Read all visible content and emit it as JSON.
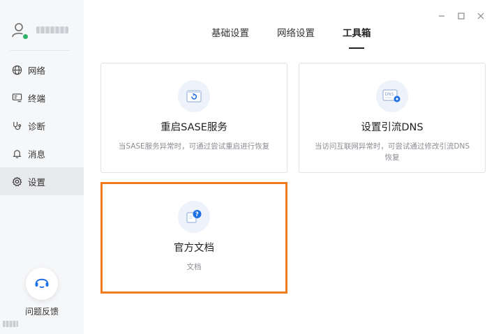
{
  "window": {
    "minimize_icon": "minimize-icon",
    "maximize_icon": "maximize-icon",
    "close_icon": "close-icon"
  },
  "sidebar": {
    "user": {
      "avatar_icon": "user-avatar-icon",
      "status_color": "#2fb36a"
    },
    "items": [
      {
        "label": "网络",
        "icon": "globe-icon",
        "active": false
      },
      {
        "label": "终端",
        "icon": "terminal-icon",
        "active": false
      },
      {
        "label": "诊断",
        "icon": "stethoscope-icon",
        "active": false
      },
      {
        "label": "消息",
        "icon": "bell-icon",
        "active": false
      },
      {
        "label": "设置",
        "icon": "gear-icon",
        "active": true
      }
    ],
    "help": {
      "label": "问题反馈",
      "icon": "headset-icon"
    }
  },
  "tabs": [
    {
      "label": "基础设置",
      "active": false
    },
    {
      "label": "网络设置",
      "active": false
    },
    {
      "label": "工具箱",
      "active": true
    }
  ],
  "cards": [
    {
      "title": "重启SASE服务",
      "desc": "当SASE服务异常时，可通过尝试重启进行恢复",
      "icon": "restart-window-icon"
    },
    {
      "title": "设置引流DNS",
      "desc": "当访问互联网异常时，可尝试通过修改引流DNS恢复",
      "icon": "dns-settings-icon",
      "icon_text": "DNS"
    },
    {
      "title": "官方文档",
      "desc": "文档",
      "icon": "document-help-icon",
      "selected": true
    }
  ],
  "colors": {
    "accent": "#1f6fe5",
    "selected_border": "#f07c1d",
    "sidebar_bg": "#f6f7f9"
  }
}
